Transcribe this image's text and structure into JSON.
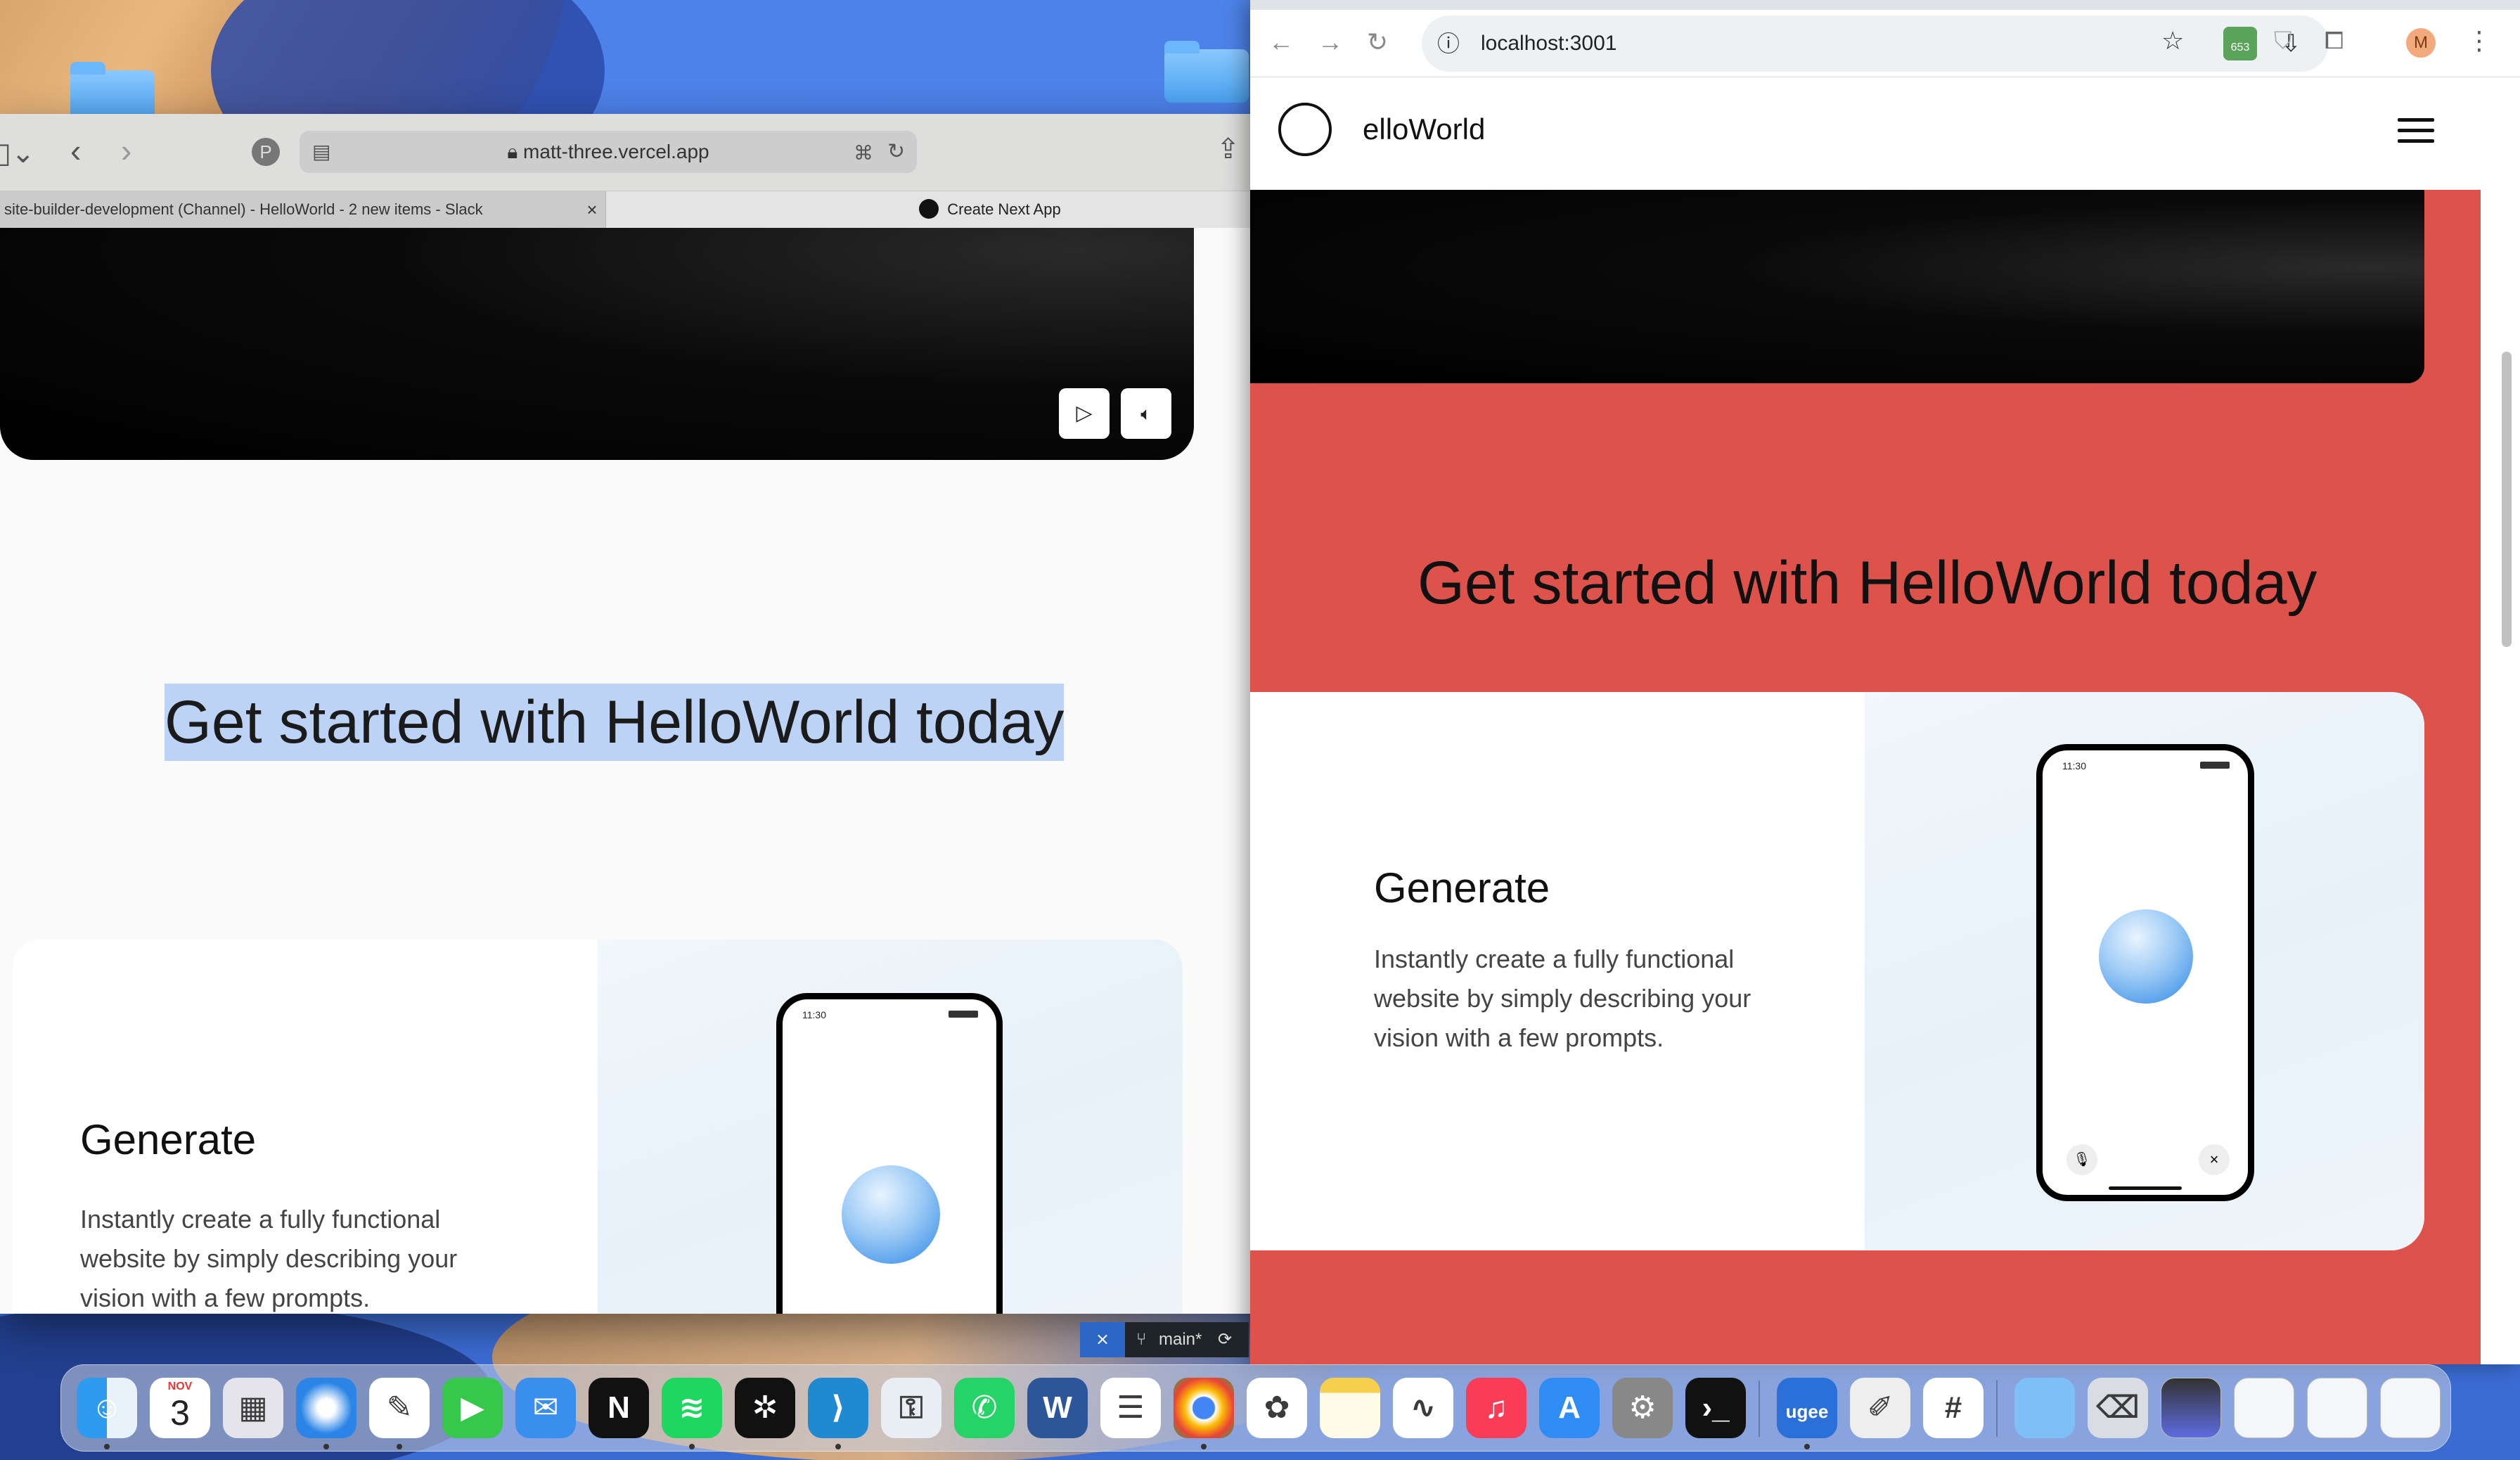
{
  "safari": {
    "url": "matt-three.vercel.app",
    "tabs": [
      {
        "label": "site-builder-development (Channel) - HelloWorld - 2 new items - Slack"
      },
      {
        "label": "Create Next App"
      }
    ],
    "heading": "Get started with HelloWorld today",
    "card": {
      "title": "Generate",
      "text_lines": [
        "Instantly create a fully functional",
        "website by simply describing your",
        "vision with a few prompts."
      ],
      "phone_time": "11:30"
    }
  },
  "chrome": {
    "url": "localhost:3001",
    "extension_badge": "653",
    "profile_initial": "M",
    "brand": "elloWorld",
    "heading": "Get started with HelloWorld today",
    "card": {
      "title": "Generate",
      "text_lines": [
        "Instantly create a fully functional",
        "website by simply describing your",
        "vision with a few prompts."
      ],
      "phone_time": "11:30"
    }
  },
  "vscode_status": {
    "branch": "main*"
  },
  "dock": {
    "calendar_month": "NOV",
    "calendar_day": "3",
    "ugee_label": "ugee",
    "apps": [
      "finder-icon",
      "calendar-icon",
      "launchpad-icon",
      "safari-icon",
      "freeform-icon",
      "facetime-icon",
      "mail-icon",
      "notion-icon",
      "spotify-icon",
      "chatgpt-icon",
      "vscode-icon",
      "keychain-icon",
      "whatsapp-icon",
      "word-icon",
      "reminders-icon",
      "chrome-icon",
      "photos-icon",
      "notes-icon",
      "freeform2-icon",
      "music-icon",
      "appstore-icon",
      "settings-icon",
      "terminal-icon",
      "ugee-icon",
      "textedit-icon",
      "slack-icon",
      "folder-icon",
      "trash-icon"
    ]
  },
  "colors": {
    "red_page": "#de524c",
    "selection": "#bcd3f6"
  }
}
